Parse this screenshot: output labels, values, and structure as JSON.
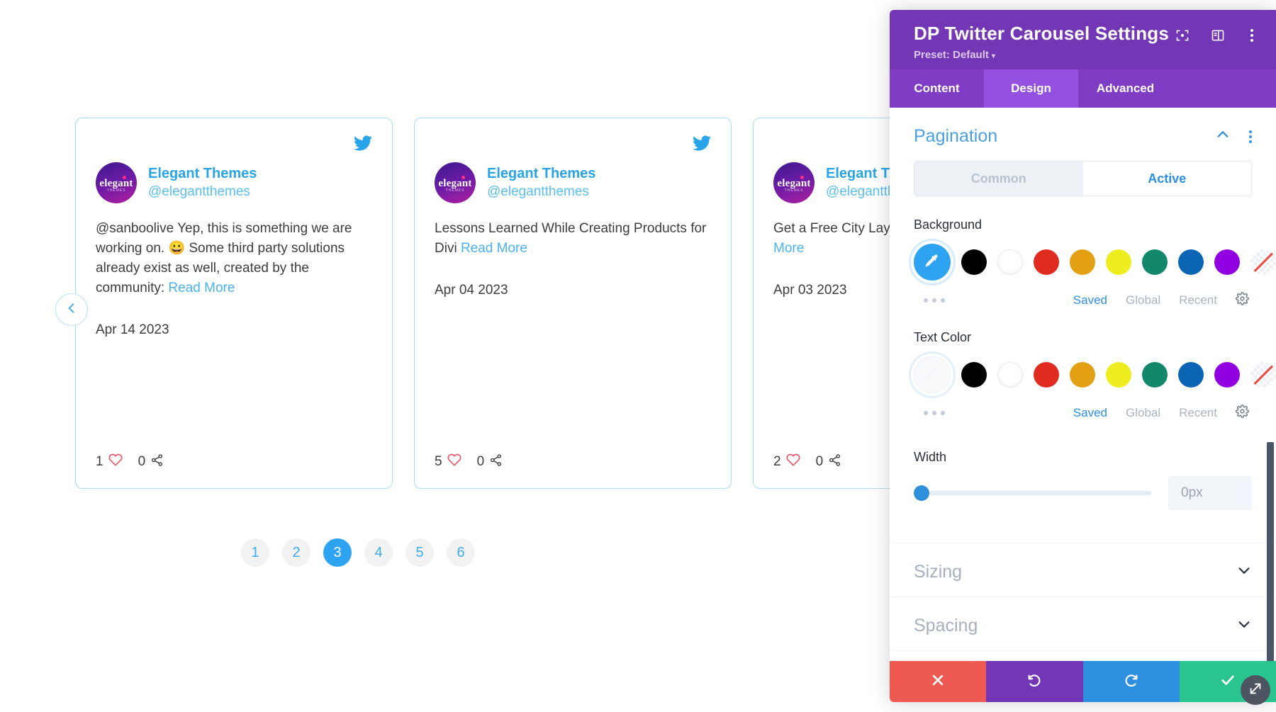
{
  "carousel": {
    "prev_button_icon": "chevron-left-icon",
    "cards": [
      {
        "display_name": "Elegant Themes",
        "handle": "@elegantthemes",
        "avatar_text": "elegant",
        "avatar_sub": "THEMES",
        "text": "@sanboolive Yep, this is something we are working on. 😀 Some third party solutions already exist as well, created by the community:",
        "read_more": "Read More",
        "date": "Apr 14 2023",
        "likes": "1",
        "shares": "0"
      },
      {
        "display_name": "Elegant Themes",
        "handle": "@elegantthemes",
        "avatar_text": "elegant",
        "avatar_sub": "THEMES",
        "text": "Lessons Learned While Creating Products for Divi ",
        "read_more": "Read More",
        "date": "Apr 04 2023",
        "likes": "5",
        "shares": "0"
      },
      {
        "display_name": "Elegant Themes",
        "handle": "@elegantthemes",
        "avatar_text": "elegant",
        "avatar_sub": "THEMES",
        "text": "Get a Free City Layout Pack for Divi ",
        "read_more": "Read More",
        "date": "Apr 03 2023",
        "likes": "2",
        "shares": "0"
      }
    ],
    "pagination": {
      "pages": [
        "1",
        "2",
        "3",
        "4",
        "5",
        "6"
      ],
      "active": "3"
    }
  },
  "panel": {
    "title": "DP Twitter Carousel Settings",
    "preset_label": "Preset: Default",
    "header_icons": [
      "focus-target-icon",
      "layout-panel-icon",
      "more-vertical-icon"
    ],
    "tabs": [
      {
        "label": "Content",
        "active": false
      },
      {
        "label": "Design",
        "active": true
      },
      {
        "label": "Advanced",
        "active": false
      }
    ],
    "sections": {
      "pagination": {
        "title": "Pagination",
        "state_toggle": {
          "common": "Common",
          "active": "Active",
          "selected": "Active"
        },
        "background": {
          "label": "Background",
          "picker_active": true,
          "swatches": [
            "#000000",
            "#ffffff",
            "#e02b20",
            "#e3a012",
            "#eded1f",
            "#12886a",
            "#0c64b4",
            "#9100e0",
            "transparent"
          ],
          "links": [
            "Saved",
            "Global",
            "Recent"
          ],
          "selected_link": "Saved",
          "settings_icon": "gear-icon"
        },
        "text_color": {
          "label": "Text Color",
          "picker_active": false,
          "swatches": [
            "#000000",
            "#ffffff",
            "#e02b20",
            "#e3a012",
            "#eded1f",
            "#12886a",
            "#0c64b4",
            "#9100e0",
            "transparent"
          ],
          "links": [
            "Saved",
            "Global",
            "Recent"
          ],
          "selected_link": "Saved",
          "settings_icon": "gear-icon"
        },
        "width": {
          "label": "Width",
          "value": "0px",
          "slider_percent": 0
        }
      },
      "sizing": {
        "title": "Sizing",
        "collapsed": true
      },
      "spacing": {
        "title": "Spacing",
        "collapsed": true
      }
    },
    "actions": [
      {
        "name": "close",
        "icon": "close-icon",
        "color": "#ee5a52"
      },
      {
        "name": "undo",
        "icon": "undo-icon",
        "color": "#7337b5"
      },
      {
        "name": "redo",
        "icon": "redo-icon",
        "color": "#2d8fe0"
      },
      {
        "name": "save",
        "icon": "check-icon",
        "color": "#2ac48f"
      }
    ],
    "resize_handle_icon": "resize-diagonal-icon"
  },
  "colors": {
    "panel_header": "#7337b5",
    "tab_active": "#9451e0",
    "accent_blue": "#2ea3f2",
    "twitter_blue": "#1da1f2"
  }
}
